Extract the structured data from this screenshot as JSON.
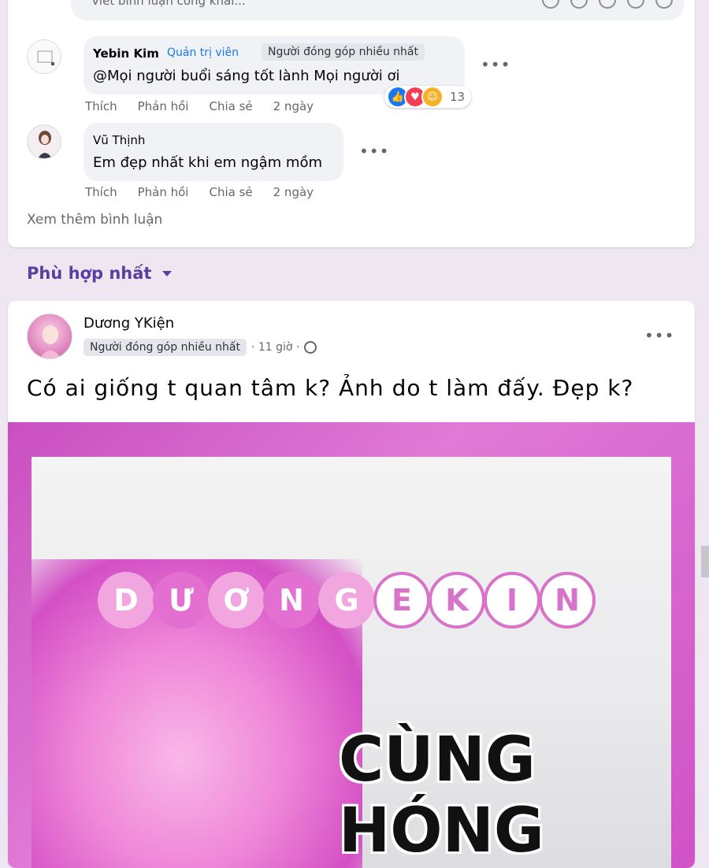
{
  "composer": {
    "placeholder": "Viết bình luận công khai..."
  },
  "comments": [
    {
      "author": "Yebin Kim",
      "admin_badge": "Quản trị viên",
      "contrib_badge": "Người đóng góp nhiều nhất",
      "text": "@Mọi người buổi sáng tốt lành Mọi người ơi",
      "actions": [
        "Thích",
        "Phản hồi",
        "Chia sẻ",
        "2 ngày"
      ],
      "reaction_count": "13"
    },
    {
      "author": "Vũ Thịnh",
      "text": "Em đẹp nhất khi em ngậm mồm",
      "actions": [
        "Thích",
        "Phản hồi",
        "Chia sẻ",
        "2 ngày"
      ]
    }
  ],
  "see_more": "Xem thêm bình luận",
  "sort_label": "Phù hợp nhất",
  "post": {
    "author": "Dương YKiện",
    "badge": "Người đóng góp nhiều nhất",
    "time": "· 11 giờ ·",
    "text": "Có ai giống t quan tâm k? Ảnh do t làm đấy. Đẹp k?",
    "image": {
      "letters": [
        "D",
        "Ư",
        "Ơ",
        "N",
        "G",
        "E",
        "K",
        "I",
        "N"
      ],
      "big_text_line1": "CÙNG",
      "big_text_line2": "HÓNG"
    }
  },
  "colors": {
    "accent": "#5b3fa0",
    "link": "#1877f2",
    "image_pink": "#d34fc5"
  }
}
